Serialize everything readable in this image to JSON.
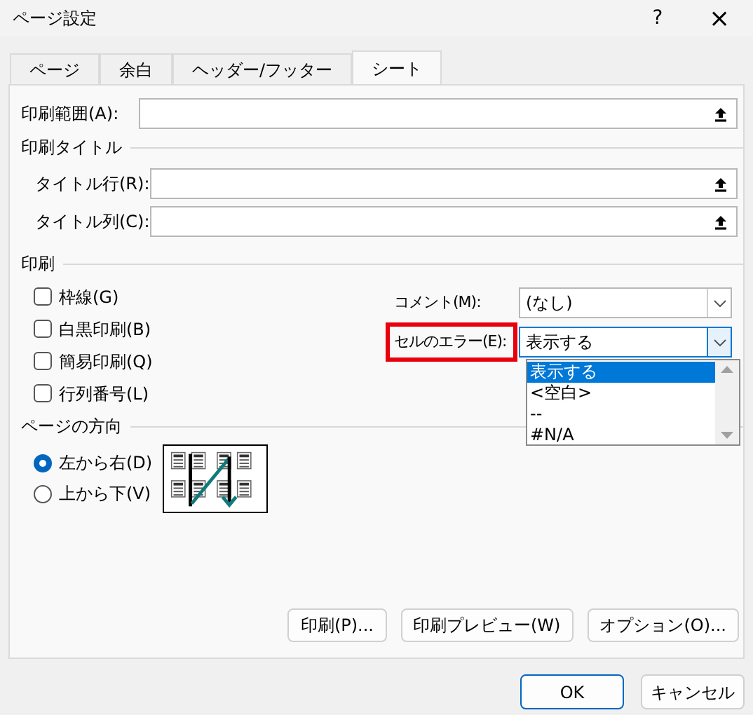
{
  "window": {
    "title": "ページ設定",
    "help_button": "?",
    "close_button": "×"
  },
  "tabs": [
    {
      "label": "ページ",
      "selected": false
    },
    {
      "label": "余白",
      "selected": false
    },
    {
      "label": "ヘッダー/フッター",
      "selected": false
    },
    {
      "label": "シート",
      "selected": true
    }
  ],
  "print_area": {
    "label": "印刷範囲(A):"
  },
  "print_titles": {
    "heading": "印刷タイトル",
    "fields": [
      {
        "label": "タイトル行(R):"
      },
      {
        "label": "タイトル列(C):"
      }
    ]
  },
  "print": {
    "heading": "印刷",
    "options": [
      {
        "label": "枠線(G)",
        "checked": false
      },
      {
        "label": "白黒印刷(B)",
        "checked": false
      },
      {
        "label": "簡易印刷(Q)",
        "checked": false
      },
      {
        "label": "行列番号(L)",
        "checked": false
      }
    ],
    "comments": {
      "label": "コメント(M):",
      "value": "(なし)",
      "highlighted": false,
      "open": false
    },
    "cell_errors": {
      "label": "セルのエラー(E):",
      "value": "表示する",
      "highlighted": true,
      "open": true,
      "list": [
        {
          "label": "表示する",
          "selected": true
        },
        {
          "label": "<空白>",
          "selected": false
        },
        {
          "label": "--",
          "selected": false
        },
        {
          "label": "#N/A",
          "selected": false
        }
      ]
    }
  },
  "page_order": {
    "heading": "ページの方向",
    "options": [
      {
        "label": "左から右(D)",
        "selected": true
      },
      {
        "label": "上から下(V)",
        "selected": false
      }
    ]
  },
  "action_buttons": [
    "印刷(P)...",
    "印刷プレビュー(W)",
    "オプション(O)..."
  ],
  "footer_buttons": [
    {
      "label": "OK",
      "default": true
    },
    {
      "label": "キャンセル",
      "default": false
    }
  ]
}
